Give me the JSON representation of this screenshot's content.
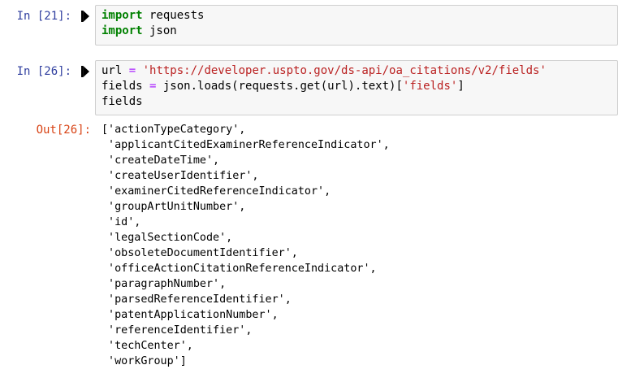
{
  "cells": [
    {
      "prompt": "In [21]:",
      "lines": [
        {
          "kw": "import",
          "rest": " requests"
        },
        {
          "kw": "import",
          "rest": " json"
        }
      ]
    },
    {
      "prompt": "In [26]:",
      "line1": {
        "var": "url ",
        "op": "=",
        "sp": " ",
        "str": "'https://developer.uspto.gov/ds-api/oa_citations/v2/fields'"
      },
      "line2": {
        "pre": "fields ",
        "op": "=",
        "mid": " json.loads(requests.get(url).text)[",
        "str": "'fields'",
        "post": "]"
      },
      "line3": "fields"
    }
  ],
  "output": {
    "prompt": "Out[26]:",
    "lines": [
      "['actionTypeCategory',",
      " 'applicantCitedExaminerReferenceIndicator',",
      " 'createDateTime',",
      " 'createUserIdentifier',",
      " 'examinerCitedReferenceIndicator',",
      " 'groupArtUnitNumber',",
      " 'id',",
      " 'legalSectionCode',",
      " 'obsoleteDocumentIdentifier',",
      " 'officeActionCitationReferenceIndicator',",
      " 'paragraphNumber',",
      " 'parsedReferenceIdentifier',",
      " 'patentApplicationNumber',",
      " 'referenceIdentifier',",
      " 'techCenter',",
      " 'workGroup']"
    ]
  },
  "colors": {
    "in_prompt": "#303f9f",
    "out_prompt": "#d84315",
    "keyword": "#008000",
    "operator": "#aa22ff",
    "string": "#ba2121",
    "input_bg": "#f7f7f7"
  },
  "icons": {
    "run": "run-cell-icon"
  }
}
